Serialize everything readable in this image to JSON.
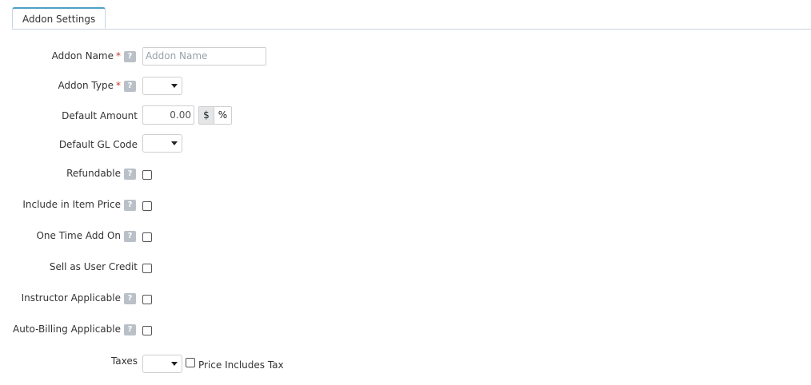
{
  "tabs": [
    {
      "label": "Addon Settings",
      "active": true
    }
  ],
  "fields": {
    "addon_name": {
      "label": "Addon Name",
      "required_mark": "*",
      "help": "?",
      "placeholder": "Addon Name",
      "value": ""
    },
    "addon_type": {
      "label": "Addon Type",
      "required_mark": "*",
      "help": "?",
      "selected": ""
    },
    "default_amount": {
      "label": "Default Amount",
      "value": "0.00",
      "unit_options": [
        "$",
        "%"
      ],
      "selected_unit": "$"
    },
    "default_gl_code": {
      "label": "Default GL Code",
      "selected": ""
    },
    "refundable": {
      "label": "Refundable",
      "help": "?",
      "checked": false
    },
    "include_in_item_price": {
      "label": "Include in Item Price",
      "help": "?",
      "checked": false
    },
    "one_time_add_on": {
      "label": "One Time Add On",
      "help": "?",
      "checked": false
    },
    "sell_as_user_credit": {
      "label": "Sell as User Credit",
      "checked": false
    },
    "instructor_applicable": {
      "label": "Instructor Applicable",
      "help": "?",
      "checked": false
    },
    "auto_billing_applicable": {
      "label": "Auto-Billing Applicable",
      "help": "?",
      "checked": false
    },
    "taxes": {
      "label": "Taxes",
      "selected": "",
      "price_includes_tax_label": "Price Includes Tax",
      "price_includes_tax_checked": false
    }
  },
  "colors": {
    "tab_accent": "#4e9ec9",
    "required": "#c0392b",
    "help_badge": "#b9c0c7"
  }
}
